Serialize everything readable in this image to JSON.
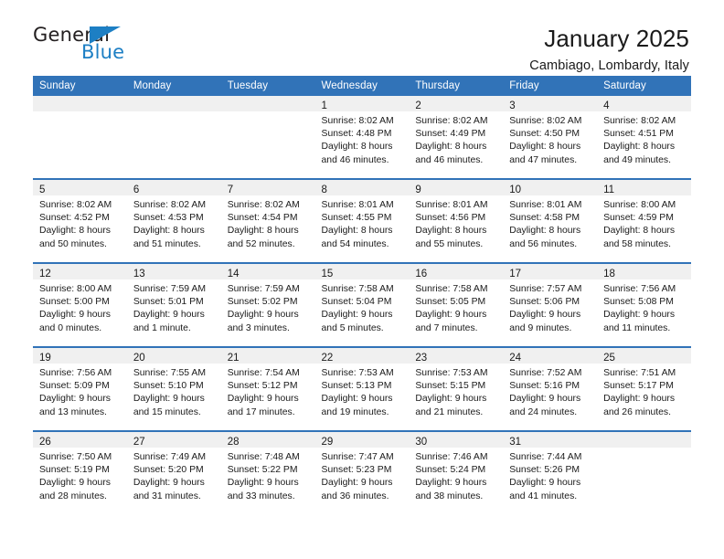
{
  "logo": {
    "word_top": "General",
    "word_bottom": "Blue",
    "accent_color": "#1d7fc4",
    "text_color": "#231f20"
  },
  "header": {
    "title": "January 2025",
    "subtitle": "Cambiago, Lombardy, Italy"
  },
  "theme": {
    "header_blue": "#3173b8",
    "daynum_band": "#f0f0f0",
    "page_background": "#ffffff"
  },
  "weekday_headers": [
    "Sunday",
    "Monday",
    "Tuesday",
    "Wednesday",
    "Thursday",
    "Friday",
    "Saturday"
  ],
  "labels": {
    "sunrise_prefix": "Sunrise:",
    "sunset_prefix": "Sunset:",
    "daylight_prefix": "Daylight:"
  },
  "weeks": [
    [
      {
        "day": "",
        "sunrise": "",
        "sunset": "",
        "daylight": "",
        "empty": true
      },
      {
        "day": "",
        "sunrise": "",
        "sunset": "",
        "daylight": "",
        "empty": true
      },
      {
        "day": "",
        "sunrise": "",
        "sunset": "",
        "daylight": "",
        "empty": true
      },
      {
        "day": "1",
        "sunrise": "Sunrise: 8:02 AM",
        "sunset": "Sunset: 4:48 PM",
        "daylight": "Daylight: 8 hours and 46 minutes.",
        "empty": false
      },
      {
        "day": "2",
        "sunrise": "Sunrise: 8:02 AM",
        "sunset": "Sunset: 4:49 PM",
        "daylight": "Daylight: 8 hours and 46 minutes.",
        "empty": false
      },
      {
        "day": "3",
        "sunrise": "Sunrise: 8:02 AM",
        "sunset": "Sunset: 4:50 PM",
        "daylight": "Daylight: 8 hours and 47 minutes.",
        "empty": false
      },
      {
        "day": "4",
        "sunrise": "Sunrise: 8:02 AM",
        "sunset": "Sunset: 4:51 PM",
        "daylight": "Daylight: 8 hours and 49 minutes.",
        "empty": false
      }
    ],
    [
      {
        "day": "5",
        "sunrise": "Sunrise: 8:02 AM",
        "sunset": "Sunset: 4:52 PM",
        "daylight": "Daylight: 8 hours and 50 minutes.",
        "empty": false
      },
      {
        "day": "6",
        "sunrise": "Sunrise: 8:02 AM",
        "sunset": "Sunset: 4:53 PM",
        "daylight": "Daylight: 8 hours and 51 minutes.",
        "empty": false
      },
      {
        "day": "7",
        "sunrise": "Sunrise: 8:02 AM",
        "sunset": "Sunset: 4:54 PM",
        "daylight": "Daylight: 8 hours and 52 minutes.",
        "empty": false
      },
      {
        "day": "8",
        "sunrise": "Sunrise: 8:01 AM",
        "sunset": "Sunset: 4:55 PM",
        "daylight": "Daylight: 8 hours and 54 minutes.",
        "empty": false
      },
      {
        "day": "9",
        "sunrise": "Sunrise: 8:01 AM",
        "sunset": "Sunset: 4:56 PM",
        "daylight": "Daylight: 8 hours and 55 minutes.",
        "empty": false
      },
      {
        "day": "10",
        "sunrise": "Sunrise: 8:01 AM",
        "sunset": "Sunset: 4:58 PM",
        "daylight": "Daylight: 8 hours and 56 minutes.",
        "empty": false
      },
      {
        "day": "11",
        "sunrise": "Sunrise: 8:00 AM",
        "sunset": "Sunset: 4:59 PM",
        "daylight": "Daylight: 8 hours and 58 minutes.",
        "empty": false
      }
    ],
    [
      {
        "day": "12",
        "sunrise": "Sunrise: 8:00 AM",
        "sunset": "Sunset: 5:00 PM",
        "daylight": "Daylight: 9 hours and 0 minutes.",
        "empty": false
      },
      {
        "day": "13",
        "sunrise": "Sunrise: 7:59 AM",
        "sunset": "Sunset: 5:01 PM",
        "daylight": "Daylight: 9 hours and 1 minute.",
        "empty": false
      },
      {
        "day": "14",
        "sunrise": "Sunrise: 7:59 AM",
        "sunset": "Sunset: 5:02 PM",
        "daylight": "Daylight: 9 hours and 3 minutes.",
        "empty": false
      },
      {
        "day": "15",
        "sunrise": "Sunrise: 7:58 AM",
        "sunset": "Sunset: 5:04 PM",
        "daylight": "Daylight: 9 hours and 5 minutes.",
        "empty": false
      },
      {
        "day": "16",
        "sunrise": "Sunrise: 7:58 AM",
        "sunset": "Sunset: 5:05 PM",
        "daylight": "Daylight: 9 hours and 7 minutes.",
        "empty": false
      },
      {
        "day": "17",
        "sunrise": "Sunrise: 7:57 AM",
        "sunset": "Sunset: 5:06 PM",
        "daylight": "Daylight: 9 hours and 9 minutes.",
        "empty": false
      },
      {
        "day": "18",
        "sunrise": "Sunrise: 7:56 AM",
        "sunset": "Sunset: 5:08 PM",
        "daylight": "Daylight: 9 hours and 11 minutes.",
        "empty": false
      }
    ],
    [
      {
        "day": "19",
        "sunrise": "Sunrise: 7:56 AM",
        "sunset": "Sunset: 5:09 PM",
        "daylight": "Daylight: 9 hours and 13 minutes.",
        "empty": false
      },
      {
        "day": "20",
        "sunrise": "Sunrise: 7:55 AM",
        "sunset": "Sunset: 5:10 PM",
        "daylight": "Daylight: 9 hours and 15 minutes.",
        "empty": false
      },
      {
        "day": "21",
        "sunrise": "Sunrise: 7:54 AM",
        "sunset": "Sunset: 5:12 PM",
        "daylight": "Daylight: 9 hours and 17 minutes.",
        "empty": false
      },
      {
        "day": "22",
        "sunrise": "Sunrise: 7:53 AM",
        "sunset": "Sunset: 5:13 PM",
        "daylight": "Daylight: 9 hours and 19 minutes.",
        "empty": false
      },
      {
        "day": "23",
        "sunrise": "Sunrise: 7:53 AM",
        "sunset": "Sunset: 5:15 PM",
        "daylight": "Daylight: 9 hours and 21 minutes.",
        "empty": false
      },
      {
        "day": "24",
        "sunrise": "Sunrise: 7:52 AM",
        "sunset": "Sunset: 5:16 PM",
        "daylight": "Daylight: 9 hours and 24 minutes.",
        "empty": false
      },
      {
        "day": "25",
        "sunrise": "Sunrise: 7:51 AM",
        "sunset": "Sunset: 5:17 PM",
        "daylight": "Daylight: 9 hours and 26 minutes.",
        "empty": false
      }
    ],
    [
      {
        "day": "26",
        "sunrise": "Sunrise: 7:50 AM",
        "sunset": "Sunset: 5:19 PM",
        "daylight": "Daylight: 9 hours and 28 minutes.",
        "empty": false
      },
      {
        "day": "27",
        "sunrise": "Sunrise: 7:49 AM",
        "sunset": "Sunset: 5:20 PM",
        "daylight": "Daylight: 9 hours and 31 minutes.",
        "empty": false
      },
      {
        "day": "28",
        "sunrise": "Sunrise: 7:48 AM",
        "sunset": "Sunset: 5:22 PM",
        "daylight": "Daylight: 9 hours and 33 minutes.",
        "empty": false
      },
      {
        "day": "29",
        "sunrise": "Sunrise: 7:47 AM",
        "sunset": "Sunset: 5:23 PM",
        "daylight": "Daylight: 9 hours and 36 minutes.",
        "empty": false
      },
      {
        "day": "30",
        "sunrise": "Sunrise: 7:46 AM",
        "sunset": "Sunset: 5:24 PM",
        "daylight": "Daylight: 9 hours and 38 minutes.",
        "empty": false
      },
      {
        "day": "31",
        "sunrise": "Sunrise: 7:44 AM",
        "sunset": "Sunset: 5:26 PM",
        "daylight": "Daylight: 9 hours and 41 minutes.",
        "empty": false
      },
      {
        "day": "",
        "sunrise": "",
        "sunset": "",
        "daylight": "",
        "empty": true
      }
    ]
  ]
}
